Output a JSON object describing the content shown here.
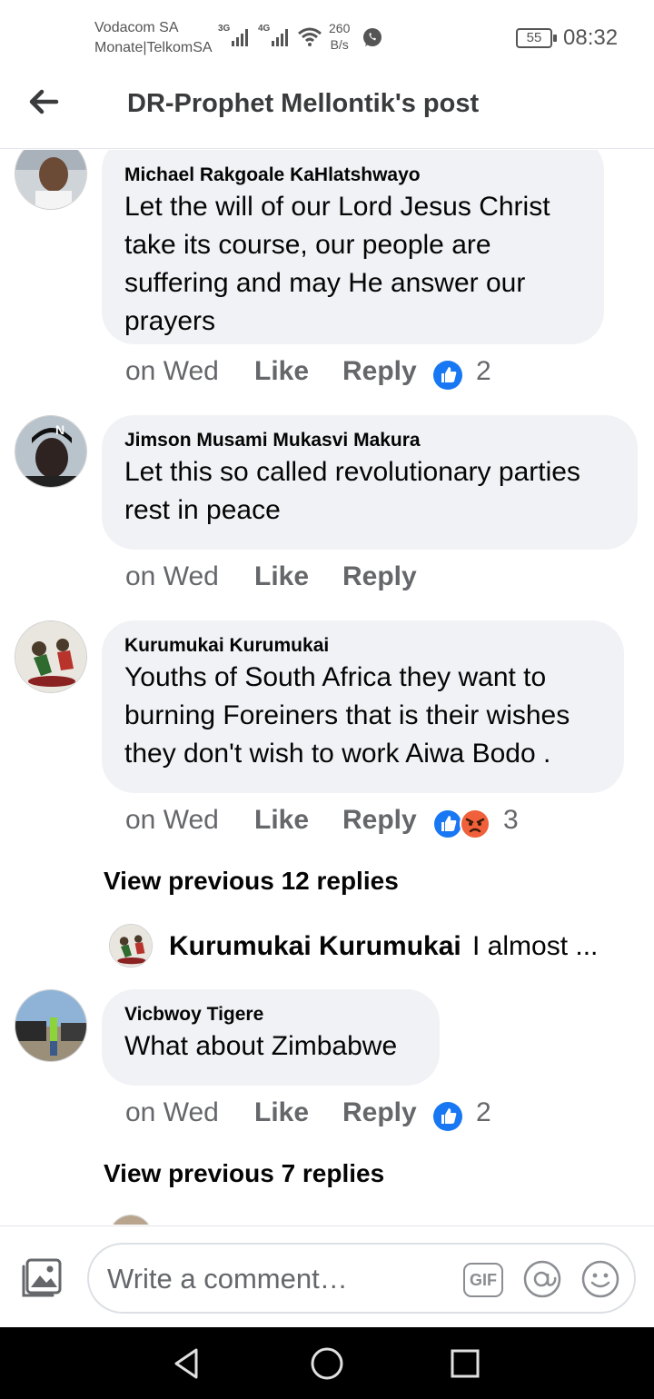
{
  "status_bar": {
    "carrier_1": "Vodacom SA",
    "carrier_2": "Monate|TelkomSA",
    "net_3g": "3G",
    "net_4g": "4G",
    "speed_value": "260",
    "speed_unit": "B/s",
    "battery": "55",
    "time": "08:32"
  },
  "header": {
    "title": "DR-Prophet Mellontik's post"
  },
  "comments": [
    {
      "author": "Michael Rakgoale KaHlatshwayo",
      "text": "Let the will of our Lord Jesus Christ take its course, our people are suffering and may He answer our prayers",
      "time": "on Wed",
      "like_label": "Like",
      "reply_label": "Reply",
      "reaction_count": "2"
    },
    {
      "author": "Jimson Musami Mukasvi Makura",
      "text": "Let this so called revolutionary parties rest in peace",
      "time": "on Wed",
      "like_label": "Like",
      "reply_label": "Reply"
    },
    {
      "author": "Kurumukai Kurumukai",
      "text": "Youths of South Africa they want to burning Foreiners that is their wishes they don't wish to work Aiwa Bodo .",
      "time": "on Wed",
      "like_label": "Like",
      "reply_label": "Reply",
      "reaction_count": "3"
    },
    {
      "author": "Vicbwoy Tigere",
      "text": "What about Zimbabwe",
      "time": "on Wed",
      "like_label": "Like",
      "reply_label": "Reply",
      "reaction_count": "2"
    }
  ],
  "view_previous_1": "View previous 12 replies",
  "reply_preview": {
    "author": "Kurumukai Kurumukai",
    "text": "I almost ..."
  },
  "view_previous_2": "View previous 7 replies",
  "composer": {
    "placeholder": "Write a comment…",
    "gif_label": "GIF"
  },
  "colors": {
    "like_blue": "#1877f2",
    "angry_orange": "#f0603a",
    "bubble_gray": "#f0f2f5",
    "secondary_text": "#65676b"
  },
  "icons": [
    "back-arrow-icon",
    "like-reaction-icon",
    "angry-reaction-icon",
    "photo-icon",
    "gif-icon",
    "mention-icon",
    "emoji-icon",
    "nav-back-icon",
    "nav-home-icon",
    "nav-recents-icon",
    "whatsapp-icon",
    "wifi-icon",
    "signal-icon"
  ]
}
